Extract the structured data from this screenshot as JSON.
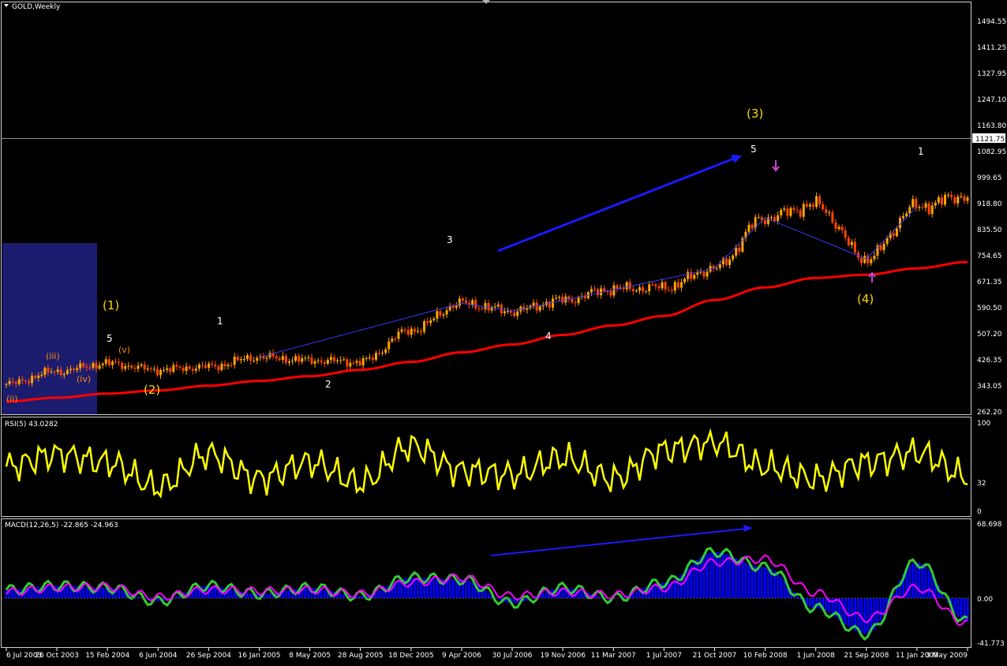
{
  "window": {
    "title": "GOLD,Weekly"
  },
  "price_axis": {
    "current": "1121.75",
    "ticks": [
      "1494.55",
      "1411.25",
      "1327.95",
      "1247.10",
      "1163.80",
      "1082.95",
      "999.65",
      "918.80",
      "835.50",
      "754.65",
      "671.35",
      "590.50",
      "507.20",
      "426.35",
      "343.05",
      "262.20"
    ]
  },
  "rsi": {
    "label": "RSI(5) 43.0282",
    "ticks": [
      "100",
      "32",
      "0"
    ]
  },
  "macd": {
    "label": "MACD(12,26,5) -22.865 -24.963",
    "ticks": [
      "68.698",
      "0.00",
      "-41.773"
    ]
  },
  "time_axis": {
    "labels": [
      "6 Jul 2003",
      "26 Oct 2003",
      "15 Feb 2004",
      "6 Jun 2004",
      "26 Sep 2004",
      "16 Jan 2005",
      "8 May 2005",
      "28 Aug 2005",
      "18 Dec 2005",
      "9 Apr 2006",
      "30 Jul 2006",
      "19 Nov 2006",
      "11 Mar 2007",
      "1 Jul 2007",
      "21 Oct 2007",
      "10 Feb 2008",
      "1 Jun 2008",
      "21 Sep 2008",
      "11 Jan 2009",
      "3 May 2009"
    ]
  },
  "wave_labels": [
    {
      "text": "(1)",
      "color": "#ffd700"
    },
    {
      "text": "5",
      "color": "#ffffff"
    },
    {
      "text": "(iii)",
      "color": "#ff8c00"
    },
    {
      "text": "(v)",
      "color": "#ff8c00"
    },
    {
      "text": "(iv)",
      "color": "#ff8c00"
    },
    {
      "text": "(ii)",
      "color": "#ff8c00"
    },
    {
      "text": "(2)",
      "color": "#ffd700"
    },
    {
      "text": "1",
      "color": "#ffffff"
    },
    {
      "text": "2",
      "color": "#ffffff"
    },
    {
      "text": "3",
      "color": "#ffffff"
    },
    {
      "text": "4",
      "color": "#ffffff"
    },
    {
      "text": "(3)",
      "color": "#ffd700"
    },
    {
      "text": "5",
      "color": "#ffffff"
    },
    {
      "text": "(4)",
      "color": "#ffd700"
    },
    {
      "text": "1",
      "color": "#ffffff"
    }
  ],
  "chart_data": {
    "type": "line",
    "title": "GOLD,Weekly",
    "x": [
      "6 Jul 2003",
      "26 Oct 2003",
      "15 Feb 2004",
      "6 Jun 2004",
      "26 Sep 2004",
      "16 Jan 2005",
      "8 May 2005",
      "28 Aug 2005",
      "18 Dec 2005",
      "9 Apr 2006",
      "30 Jul 2006",
      "19 Nov 2006",
      "11 Mar 2007",
      "1 Jul 2007",
      "21 Oct 2007",
      "10 Feb 2008",
      "1 Jun 2008",
      "21 Sep 2008",
      "11 Jan 2009",
      "3 May 2009"
    ],
    "ylim": [
      262.2,
      1494.55
    ],
    "colors": {
      "price_up": "#ffa500",
      "price_down": "#ff4500",
      "ma": "#ff0000",
      "rsi": "#ffff00",
      "macd_main": "#33cc33",
      "macd_signal": "#ff00ff",
      "macd_hist": "#0000ff",
      "arrow": "#1a1aff",
      "axis": "#ffffff"
    },
    "series": [
      {
        "values": [
          355,
          395,
          420,
          400,
          410,
          440,
          430,
          425,
          525,
          610,
          585,
          620,
          655,
          660,
          720,
          880,
          920,
          750,
          915,
          950
        ]
      },
      {
        "values": [
          300,
          312,
          325,
          335,
          350,
          365,
          380,
          400,
          425,
          455,
          480,
          510,
          540,
          570,
          620,
          660,
          690,
          700,
          720,
          740
        ]
      }
    ],
    "rsi_values": [
      55,
      70,
      60,
      30,
      70,
      40,
      60,
      35,
      80,
      50,
      45,
      65,
      40,
      75,
      85,
      55,
      40,
      60,
      72,
      43
    ],
    "macd_values": [
      8,
      12,
      10,
      -3,
      12,
      4,
      10,
      2,
      20,
      18,
      -5,
      10,
      0,
      15,
      45,
      30,
      -10,
      -35,
      35,
      -23
    ],
    "macd_signal_values": [
      6,
      10,
      11,
      1,
      8,
      7,
      8,
      4,
      15,
      20,
      2,
      6,
      3,
      10,
      35,
      38,
      5,
      -20,
      10,
      -25
    ]
  }
}
